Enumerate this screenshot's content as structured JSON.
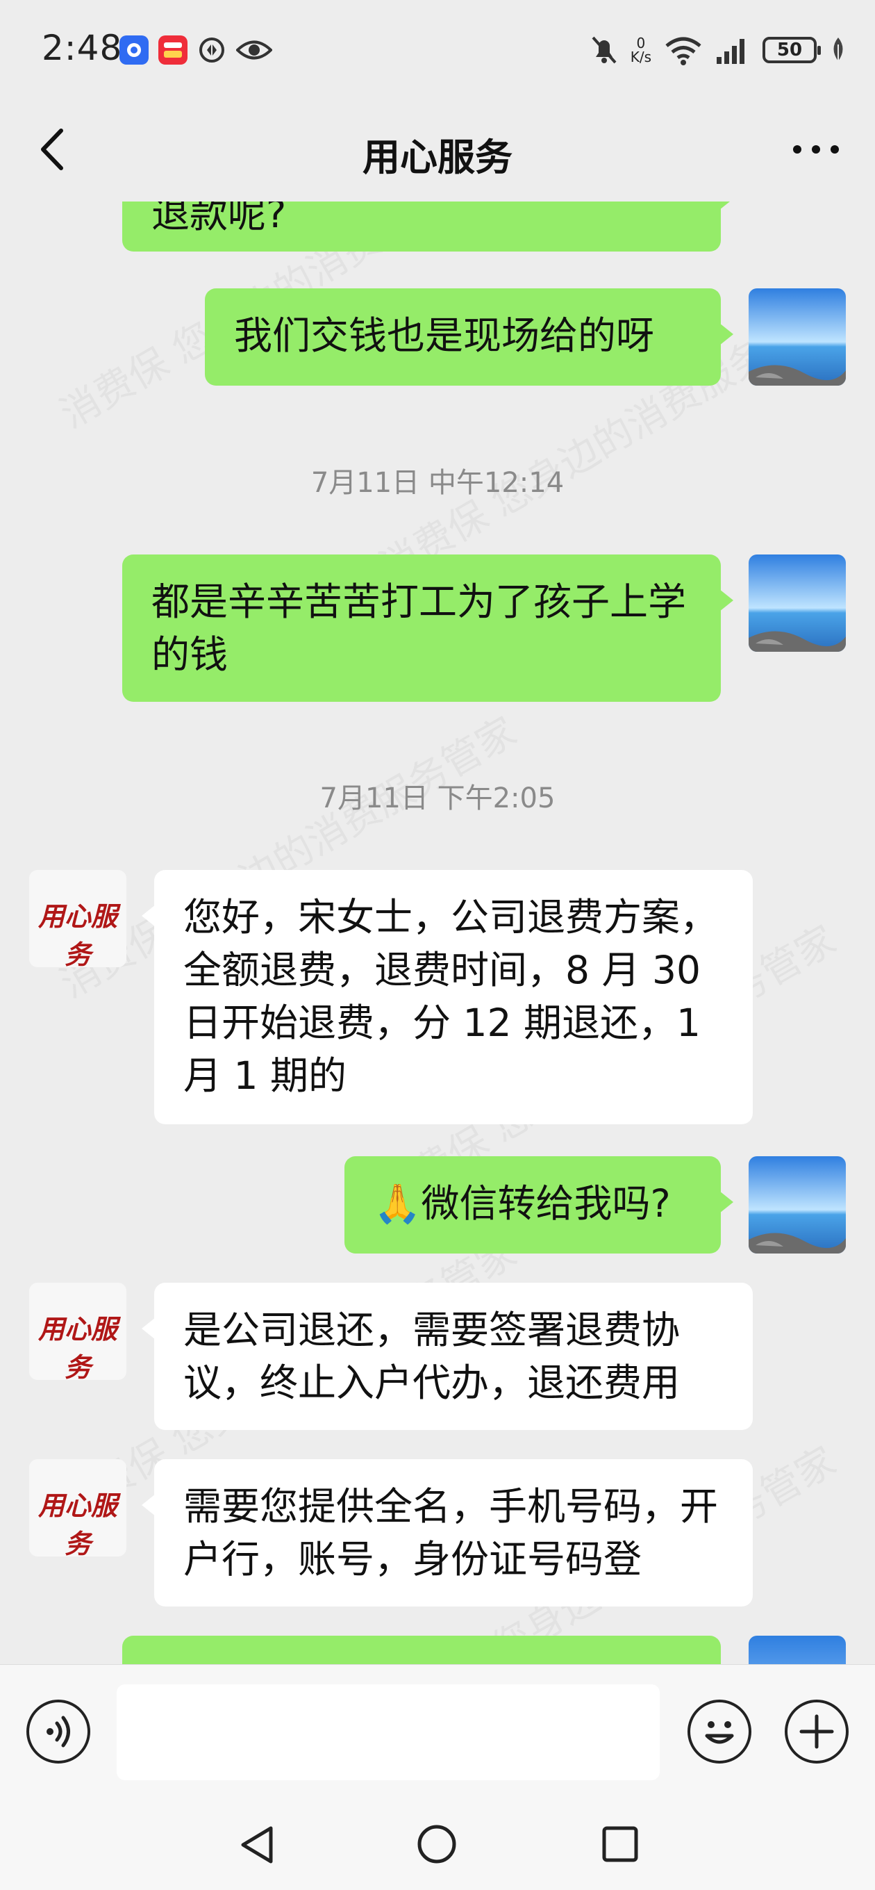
{
  "status_bar": {
    "time": "2:48",
    "net_speed_value": "0",
    "net_speed_unit": "K/s",
    "battery": "50",
    "left_icons": [
      "app-blue-icon",
      "app-red-icon",
      "sync-icon",
      "eye-icon"
    ],
    "right_icons": [
      "mute-icon",
      "wifi-icon",
      "signal-icon",
      "battery-icon",
      "leaf-icon"
    ]
  },
  "header": {
    "title": "用心服务"
  },
  "messages": [
    {
      "from": "me",
      "text": "退款呢?"
    },
    {
      "from": "me",
      "text": "我们交钱也是现场给的呀"
    },
    {
      "timestamp": "7月11日 中午12:14"
    },
    {
      "from": "me",
      "text": "都是辛辛苦苦打工为了孩子上学的钱"
    },
    {
      "timestamp": "7月11日 下午2:05"
    },
    {
      "from": "service",
      "text": "您好，宋女士，公司退费方案，全额退费，退费时间，8 月 30 日开始退费，分 12 期退还，1 月 1 期的"
    },
    {
      "from": "me",
      "text": "🙏微信转给我吗?"
    },
    {
      "from": "service",
      "text": "是公司退还，需要签署退费协议，终止入户代办，退还费用"
    },
    {
      "from": "service",
      "text": "需要您提供全名，手机号码，开户行，账号，身份证号码登"
    }
  ],
  "service_avatar_text": "用心服务",
  "watermark": [
    "消费保",
    "您身边的消费服务管家"
  ],
  "colors": {
    "my_bubble": "#95ec69",
    "their_bubble": "#ffffff",
    "background": "#ededed",
    "timestamp": "#8a8a8a"
  },
  "input_bar": {
    "icons": [
      "voice-icon",
      "emoji-icon",
      "plus-icon"
    ]
  },
  "system_nav": {
    "icons": [
      "back-triangle-icon",
      "home-circle-icon",
      "recents-square-icon"
    ]
  }
}
